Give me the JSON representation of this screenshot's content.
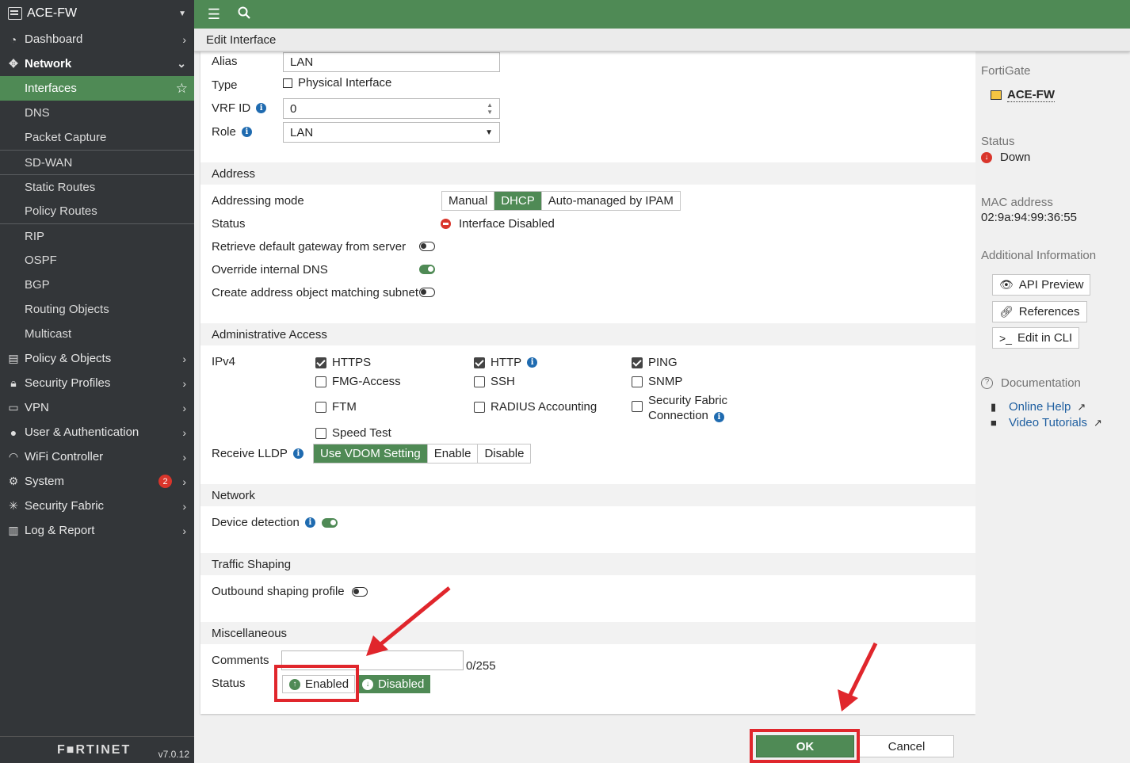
{
  "sidebar": {
    "device_name": "ACE-FW",
    "items": [
      {
        "label": "Dashboard",
        "icon": "dashboard-icon"
      },
      {
        "label": "Network",
        "icon": "network-icon"
      },
      {
        "label": "Policy & Objects",
        "icon": "policy-icon"
      },
      {
        "label": "Security Profiles",
        "icon": "lock-icon"
      },
      {
        "label": "VPN",
        "icon": "vpn-icon"
      },
      {
        "label": "User & Authentication",
        "icon": "user-icon"
      },
      {
        "label": "WiFi Controller",
        "icon": "wifi-icon"
      },
      {
        "label": "System",
        "icon": "gear-icon",
        "badge": "2"
      },
      {
        "label": "Security Fabric",
        "icon": "fabric-icon"
      },
      {
        "label": "Log & Report",
        "icon": "chart-icon"
      }
    ],
    "network_sub": [
      "Interfaces",
      "DNS",
      "Packet Capture",
      "SD-WAN",
      "Static Routes",
      "Policy Routes",
      "RIP",
      "OSPF",
      "BGP",
      "Routing Objects",
      "Multicast"
    ],
    "footer_logo": "F■RTINET",
    "version": "v7.0.12"
  },
  "page_title": "Edit Interface",
  "form": {
    "alias_label": "Alias",
    "alias_value": "LAN",
    "type_label": "Type",
    "type_value": "Physical Interface",
    "vrf_label": "VRF ID",
    "vrf_value": "0",
    "role_label": "Role",
    "role_value": "LAN",
    "address": {
      "section": "Address",
      "mode_label": "Addressing mode",
      "modes": [
        "Manual",
        "DHCP",
        "Auto-managed by IPAM"
      ],
      "selected_mode": "DHCP",
      "status_label": "Status",
      "status_value": "Interface Disabled",
      "retrieve_gw_label": "Retrieve default gateway from server",
      "override_dns_label": "Override internal DNS",
      "create_addr_label": "Create address object matching subnet"
    },
    "admin": {
      "section": "Administrative Access",
      "ipv4_label": "IPv4",
      "options": [
        {
          "label": "HTTPS",
          "checked": true
        },
        {
          "label": "HTTP",
          "checked": true
        },
        {
          "label": "PING",
          "checked": true
        },
        {
          "label": "FMG-Access",
          "checked": false
        },
        {
          "label": "SSH",
          "checked": false
        },
        {
          "label": "SNMP",
          "checked": false
        },
        {
          "label": "FTM",
          "checked": false
        },
        {
          "label": "RADIUS Accounting",
          "checked": false
        },
        {
          "label": "Security Fabric",
          "checked": false
        },
        {
          "label": "Speed Test",
          "checked": false
        }
      ],
      "fabric_line2": "Connection",
      "lldp_label": "Receive LLDP",
      "lldp_options": [
        "Use VDOM Setting",
        "Enable",
        "Disable"
      ]
    },
    "network": {
      "section": "Network",
      "device_detection_label": "Device detection"
    },
    "traffic": {
      "section": "Traffic Shaping",
      "outbound_label": "Outbound shaping profile"
    },
    "misc": {
      "section": "Miscellaneous",
      "comments_label": "Comments",
      "comments_value": "",
      "comments_count": "0/255",
      "status_label": "Status",
      "enabled_label": "Enabled",
      "disabled_label": "Disabled"
    }
  },
  "right_panel": {
    "fortigate_label": "FortiGate",
    "device_name": "ACE-FW",
    "status_label": "Status",
    "status_value": "Down",
    "mac_label": "MAC address",
    "mac_value": "02:9a:94:99:36:55",
    "additional_label": "Additional Information",
    "api_preview": "API Preview",
    "references": "References",
    "edit_cli": "Edit in CLI",
    "doc_label": "Documentation",
    "online_help": "Online Help",
    "video_tutorials": "Video Tutorials"
  },
  "buttons": {
    "ok": "OK",
    "cancel": "Cancel"
  },
  "colors": {
    "accent": "#4f8a55",
    "sidebar": "#333639",
    "highlight": "#e0262c",
    "link": "#1f5fa0"
  }
}
